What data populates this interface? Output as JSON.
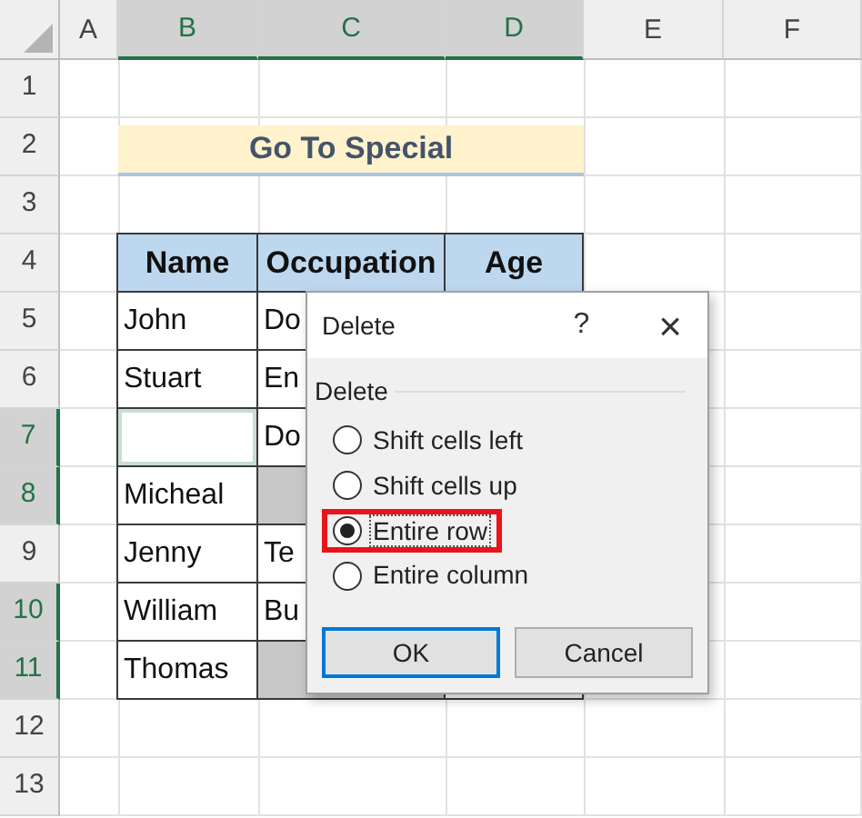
{
  "columns": [
    {
      "label": "A",
      "selected": false
    },
    {
      "label": "B",
      "selected": true
    },
    {
      "label": "C",
      "selected": true
    },
    {
      "label": "D",
      "selected": true
    },
    {
      "label": "E",
      "selected": false
    },
    {
      "label": "F",
      "selected": false
    }
  ],
  "rows": [
    {
      "label": "1",
      "selected": false
    },
    {
      "label": "2",
      "selected": false
    },
    {
      "label": "3",
      "selected": false
    },
    {
      "label": "4",
      "selected": false
    },
    {
      "label": "5",
      "selected": false
    },
    {
      "label": "6",
      "selected": false
    },
    {
      "label": "7",
      "selected": true
    },
    {
      "label": "8",
      "selected": true
    },
    {
      "label": "9",
      "selected": false
    },
    {
      "label": "10",
      "selected": true
    },
    {
      "label": "11",
      "selected": true
    },
    {
      "label": "12",
      "selected": false
    },
    {
      "label": "13",
      "selected": false
    }
  ],
  "title_cell": "Go To Special",
  "table": {
    "header": [
      "Name",
      "Occupation",
      "Age"
    ],
    "rows": [
      [
        {
          "text": "John",
          "selected": false,
          "active": false
        },
        {
          "text": "Do",
          "selected": false,
          "active": false
        }
      ],
      [
        {
          "text": "Stuart",
          "selected": false,
          "active": false
        },
        {
          "text": "En",
          "selected": false,
          "active": false
        }
      ],
      [
        {
          "selected": true,
          "active": true
        },
        {
          "text": "Do",
          "selected": false,
          "active": false
        }
      ],
      [
        {
          "text": "Micheal",
          "selected": false,
          "active": false
        },
        {
          "selected": true,
          "active": false
        }
      ],
      [
        {
          "text": "Jenny",
          "selected": false,
          "active": false
        },
        {
          "text": "Te",
          "selected": false,
          "active": false
        }
      ],
      [
        {
          "text": "William",
          "selected": false,
          "active": false
        },
        {
          "text": "Bu",
          "selected": false,
          "active": false
        }
      ],
      [
        {
          "text": "Thomas",
          "selected": false,
          "active": false
        },
        {
          "selected": true,
          "active": false
        }
      ]
    ]
  },
  "dialog": {
    "title": "Delete",
    "help": "?",
    "close": "×",
    "group": "Delete",
    "options": [
      {
        "label": "Shift cells left",
        "selected": false,
        "highlighted": false
      },
      {
        "label": "Shift cells up",
        "selected": false,
        "highlighted": false
      },
      {
        "label": "Entire row",
        "selected": true,
        "highlighted": true
      },
      {
        "label": "Entire column",
        "selected": false,
        "highlighted": false
      }
    ],
    "buttons": [
      {
        "label": "OK",
        "default": true
      },
      {
        "label": "Cancel",
        "default": false
      }
    ]
  }
}
